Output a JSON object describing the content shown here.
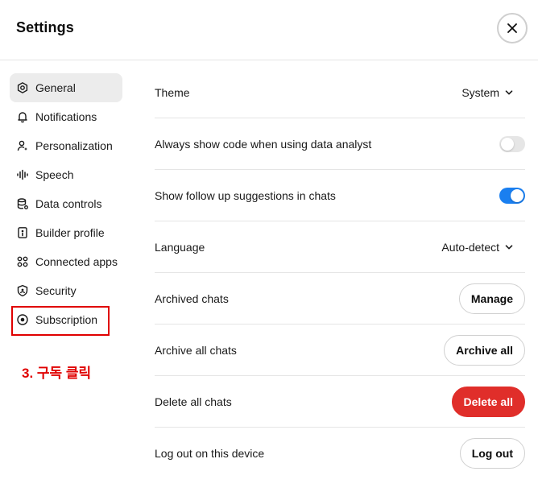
{
  "header": {
    "title": "Settings"
  },
  "sidebar": {
    "items": [
      {
        "label": "General",
        "icon": "gear-icon",
        "active": true
      },
      {
        "label": "Notifications",
        "icon": "bell-icon",
        "active": false
      },
      {
        "label": "Personalization",
        "icon": "person-icon",
        "active": false
      },
      {
        "label": "Speech",
        "icon": "waveform-icon",
        "active": false
      },
      {
        "label": "Data controls",
        "icon": "database-icon",
        "active": false
      },
      {
        "label": "Builder profile",
        "icon": "id-card-icon",
        "active": false
      },
      {
        "label": "Connected apps",
        "icon": "apps-icon",
        "active": false
      },
      {
        "label": "Security",
        "icon": "shield-icon",
        "active": false
      },
      {
        "label": "Subscription",
        "icon": "subscription-icon",
        "active": false
      }
    ]
  },
  "annotation": {
    "text": "3. 구독 클릭",
    "color": "#e00000"
  },
  "settings": {
    "theme": {
      "label": "Theme",
      "value": "System"
    },
    "show_code": {
      "label": "Always show code when using data analyst",
      "enabled": false
    },
    "follow_up": {
      "label": "Show follow up suggestions in chats",
      "enabled": true
    },
    "language": {
      "label": "Language",
      "value": "Auto-detect"
    },
    "archived_chats": {
      "label": "Archived chats",
      "button": "Manage"
    },
    "archive_all": {
      "label": "Archive all chats",
      "button": "Archive all"
    },
    "delete_all": {
      "label": "Delete all chats",
      "button": "Delete all"
    },
    "logout": {
      "label": "Log out on this device",
      "button": "Log out"
    }
  },
  "colors": {
    "accent": "#1a7ff0",
    "danger": "#e02e2a",
    "annotation": "#e00000"
  }
}
